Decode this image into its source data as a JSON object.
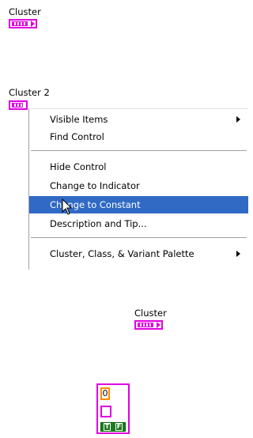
{
  "cluster1": {
    "label": "Cluster"
  },
  "cluster2": {
    "label": "Cluster 2"
  },
  "context_menu": {
    "items": [
      {
        "label": "Visible Items",
        "submenu": true
      },
      {
        "label": "Find Control"
      },
      {
        "label": "Hide Control"
      },
      {
        "label": "Change to Indicator"
      },
      {
        "label": "Change to Constant",
        "highlighted": true
      },
      {
        "label": "Description and Tip..."
      },
      {
        "label": "Cluster, Class, & Variant Palette",
        "submenu": true
      }
    ]
  },
  "cluster3": {
    "label": "Cluster"
  },
  "cluster_constant": {
    "numeric_value": "0",
    "boolean_true": "T",
    "boolean_false": "F"
  },
  "colors": {
    "cluster": "#e000e0",
    "numeric": "#ff8c00",
    "boolean": "#1f7a1f",
    "menu_highlight": "#316ac5"
  }
}
